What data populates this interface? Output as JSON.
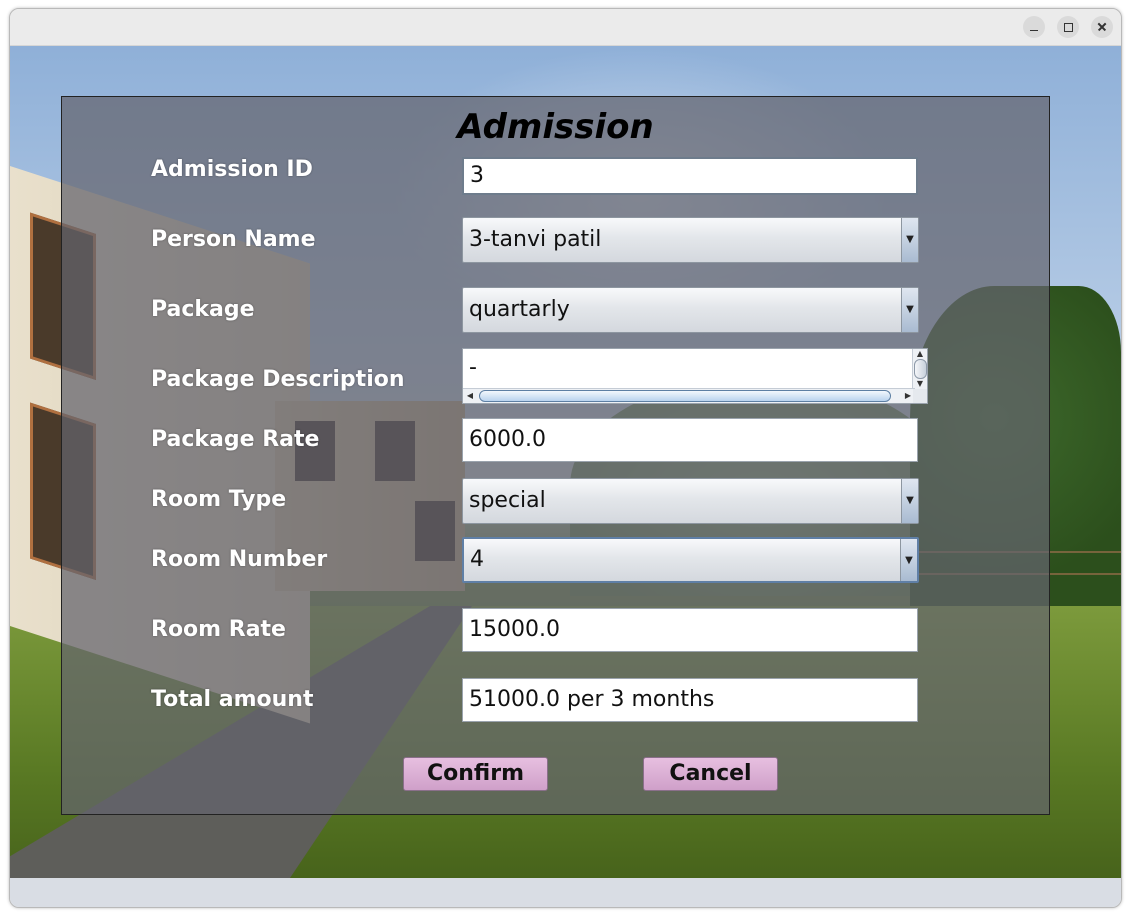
{
  "window": {
    "controls": [
      "minimize",
      "maximize",
      "close"
    ]
  },
  "form": {
    "title": "Admission",
    "admission_id": {
      "label": "Admission ID",
      "value": "3"
    },
    "person_name": {
      "label": "Person Name",
      "selected": "3-tanvi patil"
    },
    "package": {
      "label": "Package",
      "selected": "quartarly"
    },
    "package_description": {
      "label": "Package Description",
      "value": "-"
    },
    "package_rate": {
      "label": "Package Rate",
      "value": "6000.0"
    },
    "room_type": {
      "label": "Room Type",
      "selected": "special"
    },
    "room_number": {
      "label": "Room Number",
      "selected": "4"
    },
    "room_rate": {
      "label": "Room Rate",
      "value": "15000.0"
    },
    "total_amount": {
      "label": "Total amount",
      "value": "51000.0 per 3 months"
    },
    "confirm_label": "Confirm",
    "cancel_label": "Cancel"
  },
  "icons": {
    "combo_arrow": "chevron-down-icon",
    "scroll_up": "chevron-up-icon",
    "scroll_down": "chevron-down-icon",
    "scroll_left": "chevron-left-icon",
    "scroll_right": "chevron-right-icon"
  },
  "colors": {
    "button_bg": "#d9ace0",
    "panel_overlay": "#64646e",
    "label_text": "#ffffff"
  }
}
